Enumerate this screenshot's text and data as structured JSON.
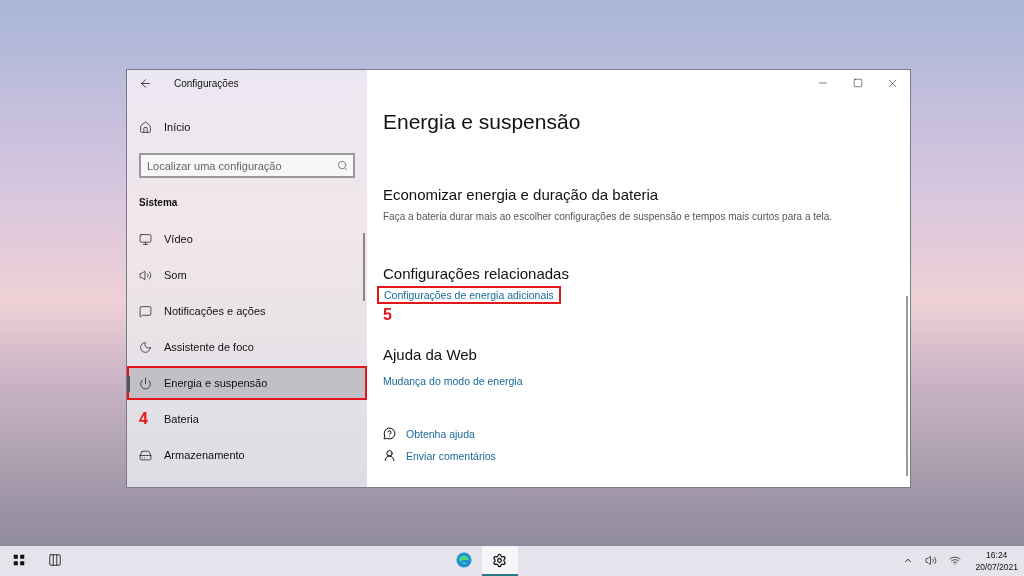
{
  "window": {
    "title": "Configurações"
  },
  "sidebar": {
    "home": "Início",
    "search": {
      "placeholder": "Localizar uma configuração"
    },
    "section": "Sistema",
    "items": [
      {
        "label": "Vídeo",
        "kind": "display",
        "selected": false,
        "highlighted": false
      },
      {
        "label": "Som",
        "kind": "sound",
        "selected": false,
        "highlighted": false
      },
      {
        "label": "Notificações e ações",
        "kind": "notifications",
        "selected": false,
        "highlighted": false
      },
      {
        "label": "Assistente de foco",
        "kind": "focus",
        "selected": false,
        "highlighted": false
      },
      {
        "label": "Energia e suspensão",
        "kind": "power",
        "selected": true,
        "highlighted": true
      },
      {
        "label": "Bateria",
        "kind": "battery",
        "selected": false,
        "highlighted": false,
        "annotation": "4"
      },
      {
        "label": "Armazenamento",
        "kind": "storage",
        "selected": false,
        "highlighted": false
      }
    ]
  },
  "content": {
    "title": "Energia e suspensão",
    "sections": [
      {
        "heading": "Economizar energia e duração da bateria",
        "description": "Faça a bateria durar mais ao escolher configurações de suspensão e tempos mais curtos para a tela."
      },
      {
        "heading": "Configurações relacionadas",
        "links": [
          {
            "label": "Configurações de energia adicionais",
            "highlighted": true,
            "annotation": "5"
          }
        ]
      },
      {
        "heading": "Ajuda da Web",
        "links": [
          {
            "label": "Mudança do modo de energia",
            "highlighted": false
          }
        ]
      }
    ],
    "help_links": [
      {
        "label": "Obtenha ajuda",
        "kind": "help"
      },
      {
        "label": "Enviar comentários",
        "kind": "feedback"
      }
    ]
  },
  "taskbar": {
    "apps": [
      {
        "kind": "browser",
        "selected": false
      },
      {
        "kind": "settings",
        "selected": true
      }
    ],
    "time": "16:24",
    "date": "20/07/2021"
  }
}
